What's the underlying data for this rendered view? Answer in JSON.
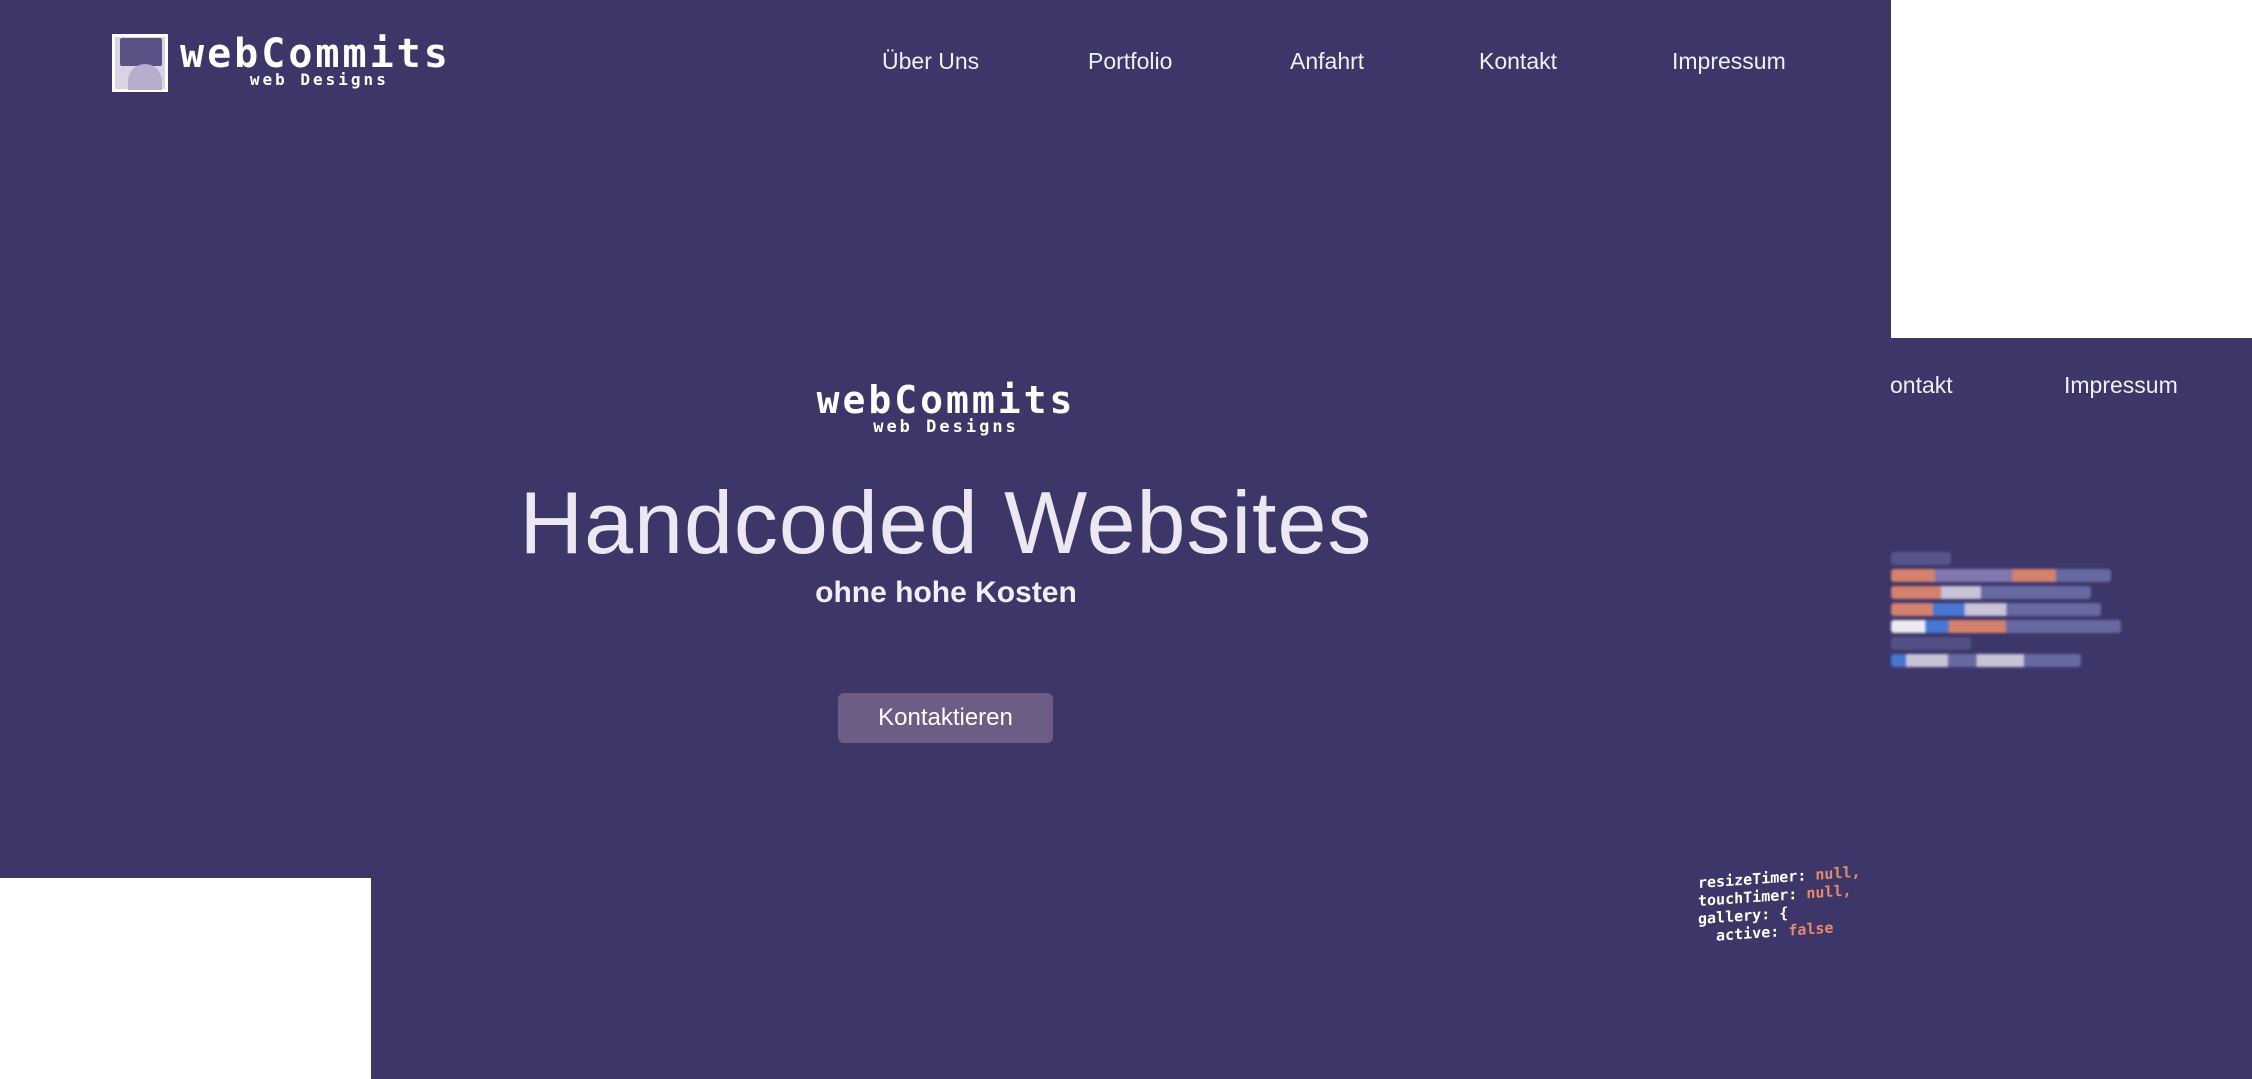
{
  "brand": {
    "name": "webCommits",
    "tagline": "web Designs"
  },
  "nav": {
    "items": [
      {
        "label": "Über Uns"
      },
      {
        "label": "Portfolio"
      },
      {
        "label": "Anfahrt"
      },
      {
        "label": "Kontakt"
      },
      {
        "label": "Impressum"
      }
    ]
  },
  "hero": {
    "logo_name": "webCommits",
    "logo_tagline": "web Designs",
    "title": "Handcoded Websites",
    "subtitle": "ohne hohe Kosten",
    "cta_label": "Kontaktieren"
  },
  "nav_duplicate": {
    "items": [
      {
        "label": "ontakt"
      },
      {
        "label": "Impressum"
      }
    ]
  },
  "code_snippet": {
    "lines": [
      {
        "key": "resizeTimer:",
        "value": "null,"
      },
      {
        "key": "touchTimer:",
        "value": "null,"
      },
      {
        "key": "gallery: {",
        "value": ""
      },
      {
        "key": "  active:",
        "value": "false"
      }
    ]
  },
  "colors": {
    "background": "#3d3669",
    "button": "#6d5d85",
    "text": "#f2eef7",
    "code_keyword": "#e58a6e"
  }
}
